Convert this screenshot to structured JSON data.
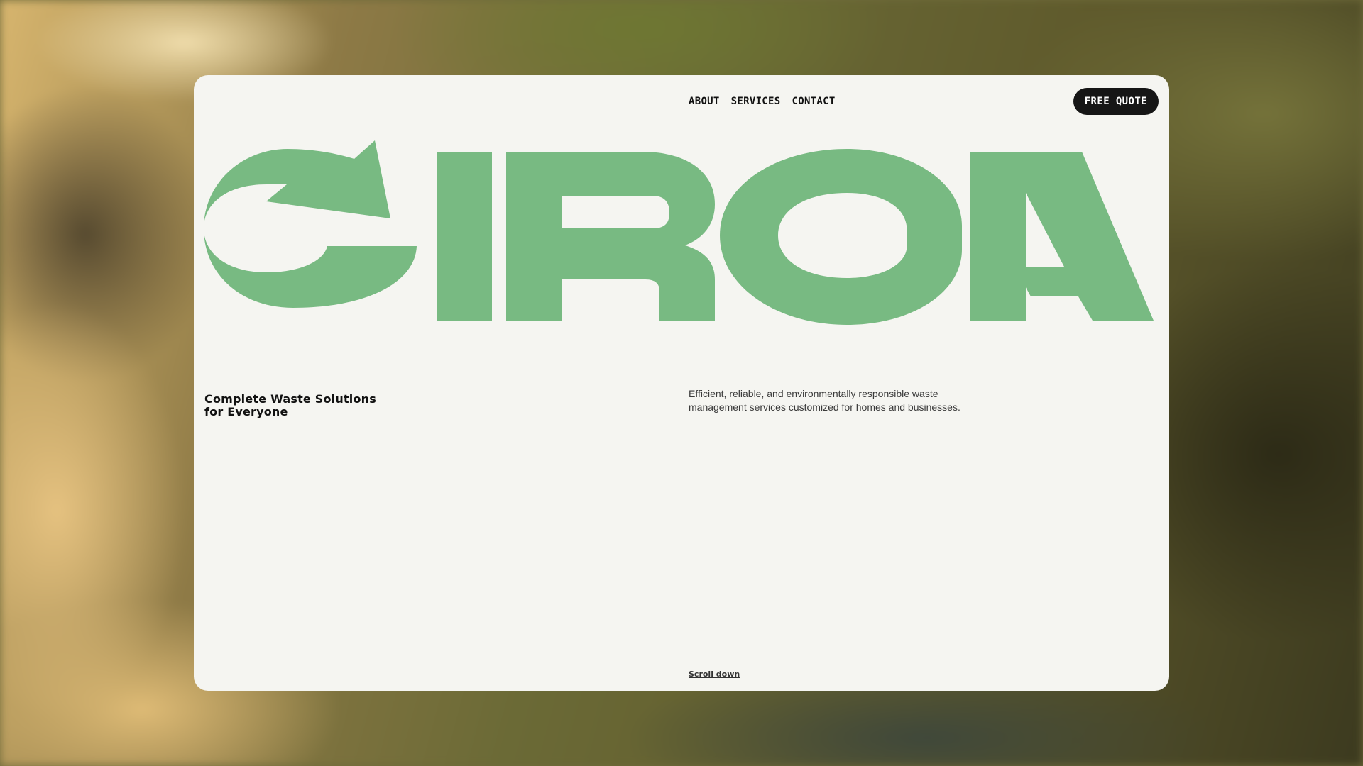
{
  "nav": {
    "items": [
      {
        "label": "ABOUT"
      },
      {
        "label": "SERVICES"
      },
      {
        "label": "CONTACT"
      }
    ],
    "cta_label": "FREE QUOTE"
  },
  "brand": {
    "wordmark": "CIRCA",
    "color": "#78ba82"
  },
  "hero": {
    "headline_line1": "Complete Waste Solutions",
    "headline_line2": "for Everyone",
    "description": "Efficient, reliable, and environmentally responsible waste management services customized for homes and businesses.",
    "scroll_label": "Scroll down"
  },
  "colors": {
    "card_bg": "#f5f5f1",
    "button_bg": "#161616",
    "text": "#111111"
  }
}
